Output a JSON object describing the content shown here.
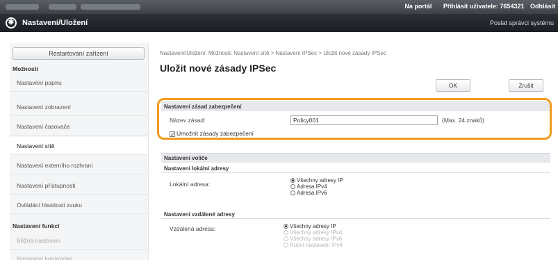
{
  "topbar": {
    "portal_link": "Na portál",
    "login_label": "Přihlásit uživatele:",
    "login_user": "7654321",
    "logout": "Odhlásit"
  },
  "titlebar": {
    "title": "Nastavení/Uložení",
    "mail_admin": "Poslat správci systému"
  },
  "sidebar": {
    "restart_button": "Restartování zařízení",
    "section_options": "Možnosti",
    "options": [
      "Nastavení papíru",
      "Nastavení zobrazení",
      "Nastavení časovače",
      "Nastavení sítě",
      "Nastavení externího rozhraní",
      "Nastavení přístupnosti",
      "Ovládání hlasitosti zvuku"
    ],
    "section_functions": "Nastavení funkcí",
    "functions": [
      "Běžná nastavení",
      "Nastavení kopírování"
    ]
  },
  "main": {
    "breadcrumb": "Nastavení/Uložení: Možnosti: Nastavení sítě > Nastavení IPSec > Uložit nové zásady IPSec",
    "page_title": "Uložit nové zásady IPSec",
    "ok_button": "OK",
    "cancel_button": "Zrušit",
    "policy_section": {
      "heading": "Nastavení zásad zabezpečení",
      "name_label": "Název zásad:",
      "name_value": "Policy001",
      "name_hint": "(Max. 24 znaků)",
      "enable_label": "Umožnit zásady zabezpečení",
      "enable_checked": true
    },
    "selector_section": {
      "heading": "Nastavení voliče",
      "local_heading": "Nastavení lokální adresy",
      "local_label": "Lokální adresa:",
      "local_options": [
        "Všechny adresy IP",
        "Adresa IPv4",
        "Adresa IPv6"
      ],
      "local_selected": "Všechny adresy IP",
      "remote_heading": "Nastavení vzdálené adresy",
      "remote_label": "Vzdálená adresa:",
      "remote_options": [
        "Všechny adresy IP",
        "Všechny adresy IPv4",
        "Všechny adresy IPv6",
        "Ruční nastavení IPv4"
      ],
      "remote_selected": "Všechny adresy IP"
    }
  },
  "colors": {
    "highlight": "#f29a1e",
    "titlebar": "#1f2227",
    "topbar": "#4a4f56"
  }
}
